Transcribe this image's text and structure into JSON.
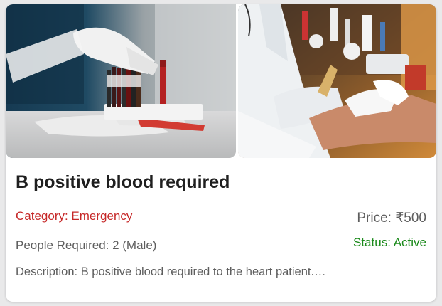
{
  "post": {
    "title": "B positive blood required",
    "category": "Category: Emergency",
    "price": "Price: ₹500",
    "people_required": "People Required: 2 (Male)",
    "status": "Status: Active",
    "description": "Description: B positive blood required to the heart patient.…"
  },
  "images": [
    {
      "icon": "blood-sample-tubes-photo"
    },
    {
      "icon": "blood-draw-photo"
    }
  ],
  "colors": {
    "category": "#c62828",
    "status": "#1b8a1b",
    "muted_text": "#5d5d5d",
    "title": "#1f1f1f"
  }
}
